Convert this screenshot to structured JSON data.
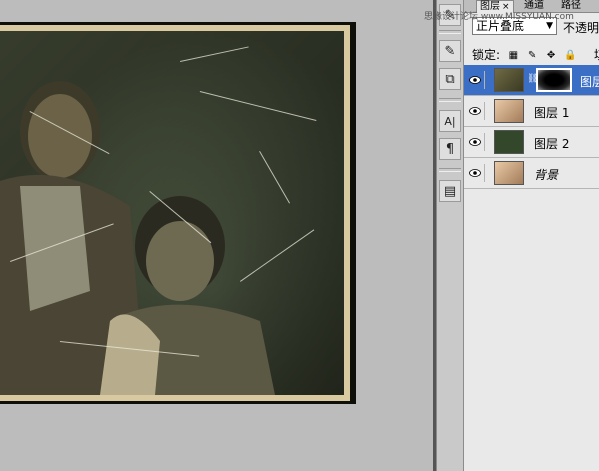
{
  "watermark": "思缘设计论坛 www.MISSYUAN.com",
  "tabs": [
    {
      "label": "图层",
      "close": "×"
    },
    {
      "label": "通道"
    },
    {
      "label": "路径"
    }
  ],
  "blend_mode": {
    "value": "正片叠底",
    "arrow": "▼"
  },
  "opacity_label": "不透明",
  "lock_label": "锁定:",
  "fill_label": "填",
  "layers": [
    {
      "name": "图层",
      "selected": true
    },
    {
      "name": "图层 1",
      "selected": false
    },
    {
      "name": "图层 2",
      "selected": false
    },
    {
      "name": "背景",
      "selected": false
    }
  ],
  "tools": [
    {
      "icon": "brush-presets-icon",
      "glyph": "✎"
    },
    {
      "icon": "clone-source-icon",
      "glyph": "⧉"
    },
    {
      "icon": "character-icon",
      "glyph": "A|"
    },
    {
      "icon": "paragraph-icon",
      "glyph": "¶"
    },
    {
      "icon": "notes-icon",
      "glyph": "▤"
    }
  ],
  "colors": {
    "selected_row": "#3b6fc5",
    "photo_border": "#d8c9a0"
  }
}
